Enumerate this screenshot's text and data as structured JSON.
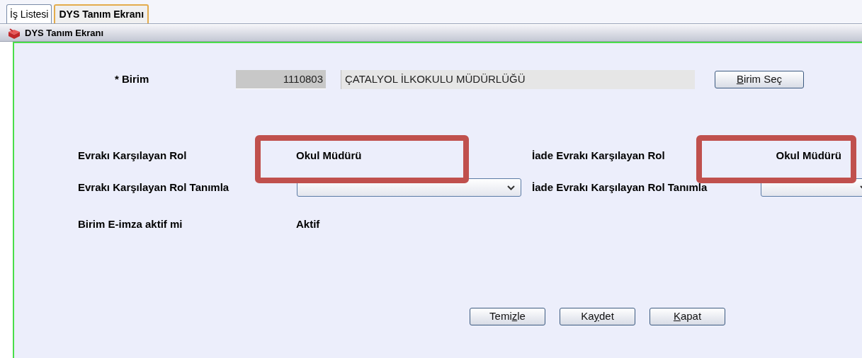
{
  "tabs": [
    {
      "label": "İş Listesi",
      "selected": false
    },
    {
      "label": "DYS Tanım Ekranı",
      "selected": true
    }
  ],
  "window": {
    "title": "DYS Tanım Ekranı"
  },
  "birim": {
    "label": "* Birim",
    "code": "1110803",
    "name": "ÇATALYOL İLKOKULU MÜDÜRLÜĞÜ",
    "button": [
      {
        "text": "B",
        "underlined": true
      },
      {
        "text": "irim Seç",
        "underlined": false
      }
    ]
  },
  "rows": [
    {
      "kind": "text",
      "label": "Evrakı Karşılayan Rol",
      "value": "Okul Müdürü",
      "highlighted": true,
      "right_label": "İade Evrakı Karşılayan Rol",
      "right_value": "Okul Müdürü",
      "right_highlighted": true
    },
    {
      "kind": "select",
      "label": "Evrakı Karşılayan Rol Tanımla",
      "right_label": "İade Evrakı Karşılayan Rol Tanımla"
    },
    {
      "kind": "text",
      "label": "Birim E-imza aktif mi",
      "value": "Aktif",
      "highlighted": false
    }
  ],
  "buttons": [
    {
      "label": [
        {
          "text": "Temi",
          "underlined": false
        },
        {
          "text": "z",
          "underlined": true
        },
        {
          "text": "le",
          "underlined": false
        }
      ]
    },
    {
      "label": [
        {
          "text": "Ka",
          "underlined": false
        },
        {
          "text": "y",
          "underlined": true
        },
        {
          "text": "det",
          "underlined": false
        }
      ]
    },
    {
      "label": [
        {
          "text": "K",
          "underlined": true
        },
        {
          "text": "apat",
          "underlined": false
        }
      ]
    }
  ]
}
